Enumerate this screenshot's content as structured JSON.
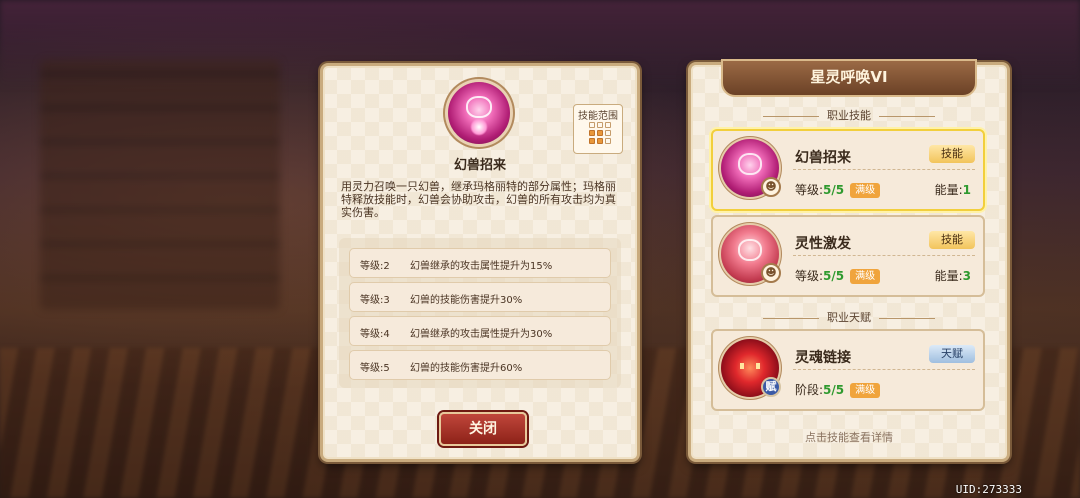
{
  "skill_detail": {
    "name": "幻兽招来",
    "range_label": "技能范围",
    "range_grid": [
      0,
      0,
      0,
      1,
      1,
      0,
      1,
      1,
      0
    ],
    "description": "用灵力召唤一只幻兽，继承玛格丽特的部分属性；玛格丽特释放技能时，幻兽会协助攻击，幻兽的所有攻击均为真实伤害。",
    "levels": [
      {
        "level": "等级:2",
        "text": "幻兽继承的攻击属性提升为15%"
      },
      {
        "level": "等级:3",
        "text": "幻兽的技能伤害提升30%"
      },
      {
        "level": "等级:4",
        "text": "幻兽继承的攻击属性提升为30%"
      },
      {
        "level": "等级:5",
        "text": "幻兽的技能伤害提升60%"
      }
    ],
    "close_label": "关闭"
  },
  "summon_panel": {
    "title": "星灵呼唤VI",
    "section_skills": "职业技能",
    "section_talent": "职业天赋",
    "skills": [
      {
        "name": "幻兽招来",
        "tag": "技能",
        "level_label": "等级:",
        "level_value": "5/5",
        "max_label": "满级",
        "energy_label": "能量:",
        "energy_value": "1",
        "selected": true
      },
      {
        "name": "灵性激发",
        "tag": "技能",
        "level_label": "等级:",
        "level_value": "5/5",
        "max_label": "满级",
        "energy_label": "能量:",
        "energy_value": "3",
        "selected": false
      }
    ],
    "talent": {
      "name": "灵魂链接",
      "tag": "天赋",
      "level_label": "阶段:",
      "level_value": "5/5",
      "max_label": "满级",
      "badge": "赋"
    },
    "hint": "点击技能查看详情"
  },
  "uid": "UID:273333",
  "colors": {
    "panel_bg": "#f7efe2",
    "close_button": "#a8342a",
    "gold_tag": "#f2c45c",
    "selected_border": "#f2cf3c",
    "value_green": "#2f9a2f"
  }
}
